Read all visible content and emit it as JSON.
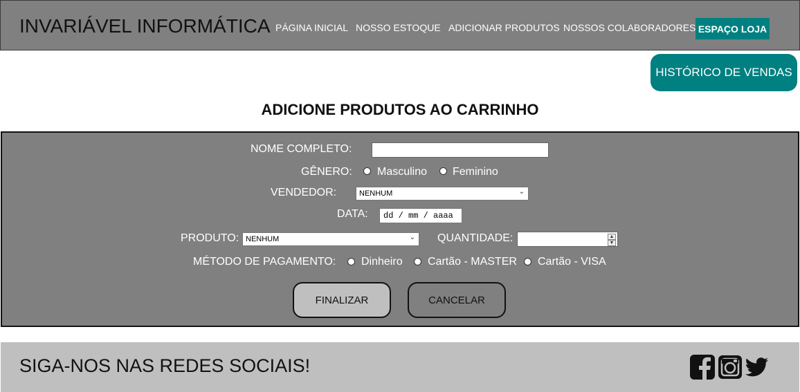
{
  "header": {
    "brand": "INVARIÁVEL INFORMÁTICA",
    "nav": {
      "home": "PÁGINA INICIAL",
      "stock": "NOSSO ESTOQUE",
      "add_products": "ADICIONAR PRODUTOS",
      "collaborators": "NOSSOS COLABORADORES",
      "store": "ESPAÇO LOJA"
    }
  },
  "sales_history_button": "HISTÓRICO DE VENDAS",
  "page_title": "ADICIONE PRODUTOS AO CARRINHO",
  "form": {
    "name_label": "NOME COMPLETO:",
    "name_value": "",
    "gender_label": "GÊNERO:",
    "gender_options": [
      "Masculino",
      "Feminino"
    ],
    "seller_label": "VENDEDOR:",
    "seller_value": "NENHUM",
    "date_label": "DATA:",
    "date_placeholder": "dd / mm / aaaa",
    "product_label": "PRODUTO:",
    "product_value": "NENHUM",
    "quantity_label": "QUANTIDADE:",
    "quantity_value": "",
    "payment_label": "MÉTODO DE PAGAMENTO:",
    "payment_options": [
      "Dinheiro",
      "Cartão - MASTER",
      "Cartão - VISA"
    ],
    "finish_button": "FINALIZAR",
    "cancel_button": "CANCELAR"
  },
  "footer": {
    "text": "SIGA-NOS NAS REDES SOCIAIS!",
    "icons": [
      "facebook-icon",
      "instagram-icon",
      "twitter-icon"
    ]
  },
  "colors": {
    "header_bg": "#808080",
    "accent": "#008080",
    "form_bg": "#808080",
    "footer_bg": "#bfbfbf",
    "finish_bg": "#bfbfbf",
    "cancel_bg": "#808080"
  }
}
